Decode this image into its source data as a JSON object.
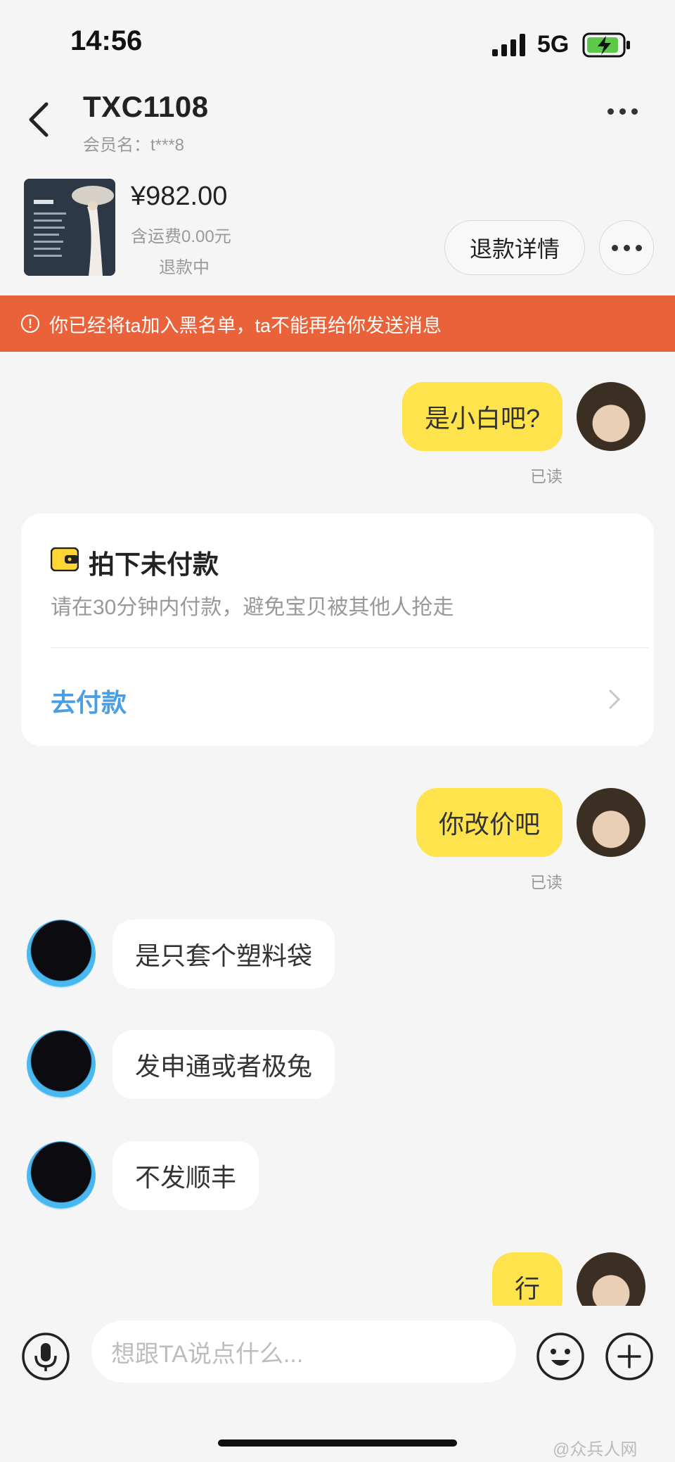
{
  "status_bar": {
    "time": "14:56",
    "network": "5G"
  },
  "header": {
    "title": "TXC1108",
    "subtitle": "会员名：t***8"
  },
  "product": {
    "price": "¥982.00",
    "shipping": "含运费0.00元",
    "status": "退款中",
    "refund_button": "退款详情"
  },
  "banner": {
    "text": "你已经将ta加入黑名单，ta不能再给你发送消息"
  },
  "messages": [
    {
      "text": "是小白吧?",
      "read": "已读"
    },
    {
      "text": "你改价吧",
      "read": "已读"
    },
    {
      "text": "是只套个塑料袋"
    },
    {
      "text": "发申通或者极兔"
    },
    {
      "text": "不发顺丰"
    },
    {
      "text": "行"
    }
  ],
  "payment_card": {
    "title": "拍下未付款",
    "desc": "请在30分钟内付款，避免宝贝被其他人抢走",
    "link": "去付款"
  },
  "input": {
    "placeholder": "想跟TA说点什么..."
  },
  "watermark": "@众兵人网",
  "colors": {
    "accent": "#ffe34d",
    "banner": "#e9623a",
    "link": "#4a9ee3"
  }
}
